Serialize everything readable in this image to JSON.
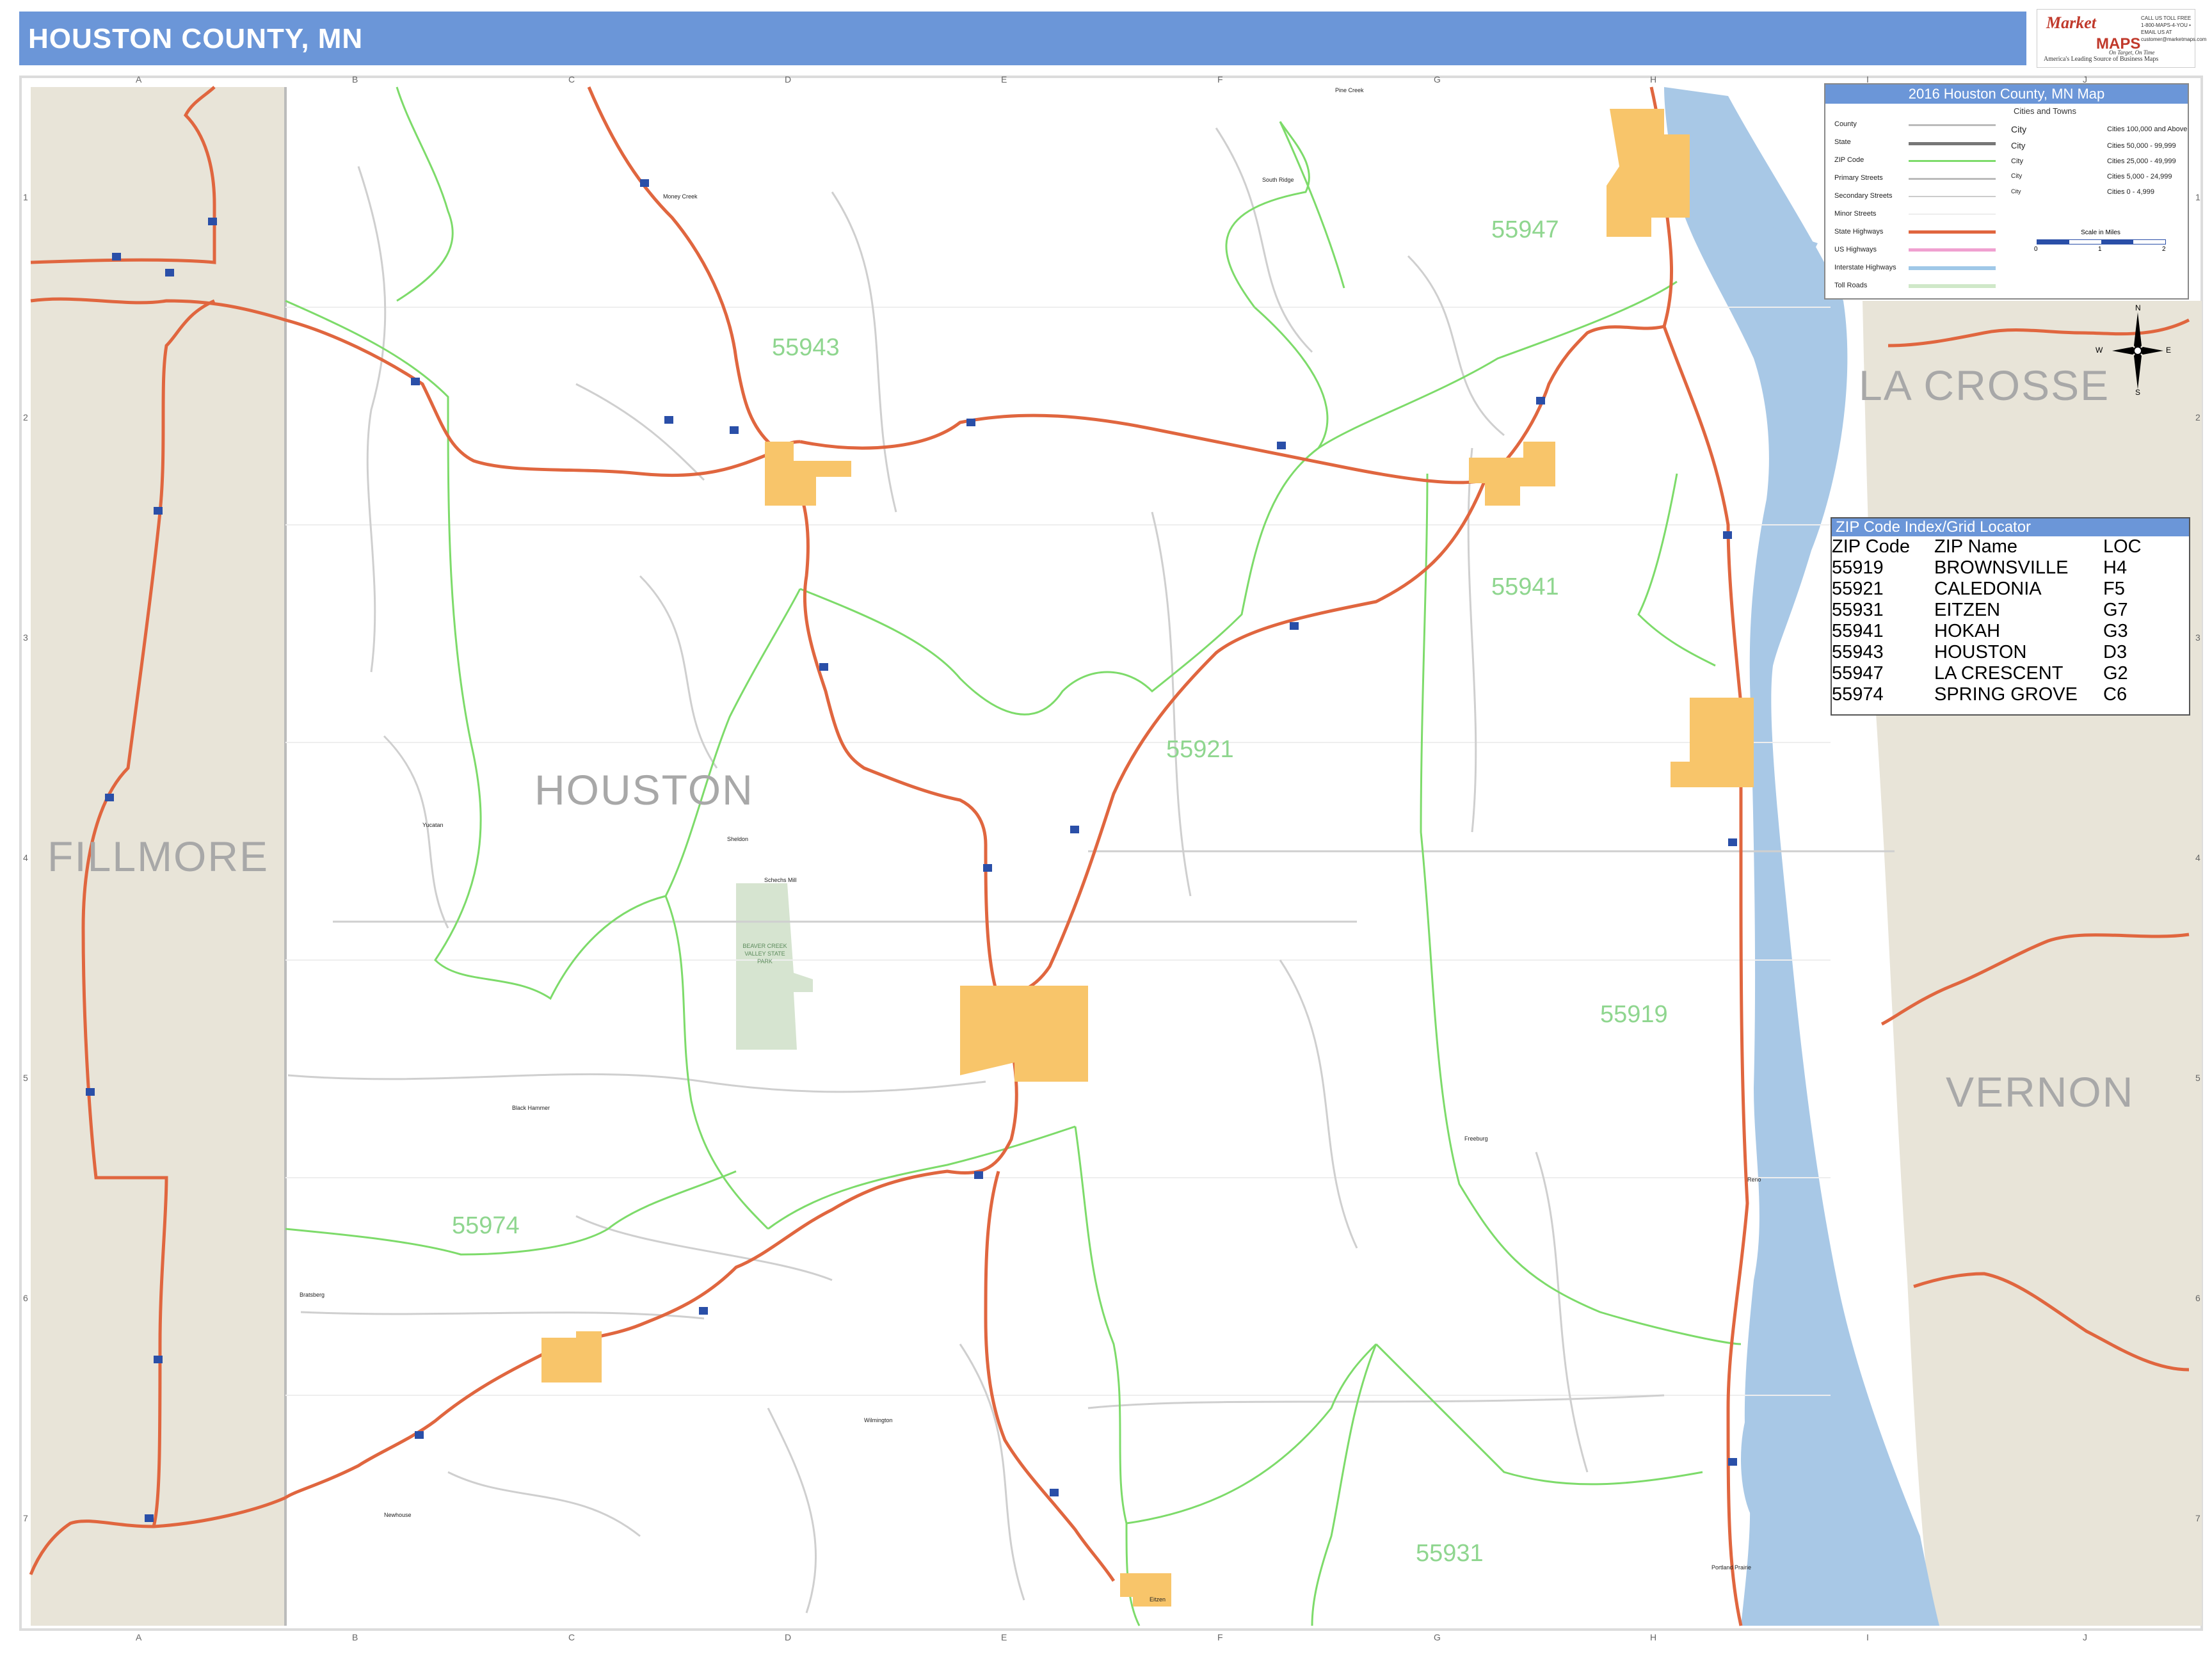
{
  "header": {
    "title": "HOUSTON COUNTY, MN"
  },
  "logo": {
    "brand_top": "Market",
    "brand_bottom": "MAPS",
    "tagline": "On Target, On Time",
    "subtitle": "America's Leading Source of Business Maps",
    "contact": "CALL US TOLL FREE 1-800-MAPS-4-YOU • EMAIL US AT customer@marketmaps.com"
  },
  "colors": {
    "header_blue": "#6b96d8",
    "water": "#a8c8e6",
    "adjacent_county": "#e8e4d8",
    "city_fill": "#f8c56a",
    "state_highway": "#e0663f",
    "zip_boundary": "#7ddb6a",
    "park": "#d6e4d0",
    "grid_line": "#dcdcdc"
  },
  "legend": {
    "title": "2016 Houston County, MN Map",
    "cities_header": "Cities and Towns",
    "rows": [
      {
        "label": "County",
        "icon": "county-line"
      },
      {
        "label": "State",
        "icon": "state-line"
      },
      {
        "label": "ZIP Code",
        "icon": "zip-line"
      },
      {
        "label": "Primary Streets",
        "icon": "primary-street-line"
      },
      {
        "label": "Secondary Streets",
        "icon": "secondary-street-line"
      },
      {
        "label": "Minor Streets",
        "icon": "minor-street-line"
      },
      {
        "label": "State Highways",
        "icon": "state-highway-line"
      },
      {
        "label": "US Highways",
        "icon": "us-highway-line"
      },
      {
        "label": "Interstate Highways",
        "icon": "interstate-line"
      },
      {
        "label": "Toll Roads",
        "icon": "toll-road-line"
      }
    ],
    "city_sizes": [
      {
        "name": "City",
        "population": "Cities 100,000 and Above"
      },
      {
        "name": "City",
        "population": "Cities 50,000 - 99,999"
      },
      {
        "name": "City",
        "population": "Cities 25,000 - 49,999"
      },
      {
        "name": "City",
        "population": "Cities 5,000 - 24,999"
      },
      {
        "name": "City",
        "population": "Cities 0 - 4,999"
      }
    ],
    "scale_title": "Scale in Miles",
    "scale_ticks": [
      "0",
      "1",
      "2"
    ]
  },
  "zip_index": {
    "title": "ZIP Code Index/Grid Locator",
    "columns": [
      "ZIP Code",
      "ZIP Name",
      "LOC"
    ],
    "rows": [
      [
        "55919",
        "BROWNSVILLE",
        "H4"
      ],
      [
        "55921",
        "CALEDONIA",
        "F5"
      ],
      [
        "55931",
        "EITZEN",
        "G7"
      ],
      [
        "55941",
        "HOKAH",
        "G3"
      ],
      [
        "55943",
        "HOUSTON",
        "D3"
      ],
      [
        "55947",
        "LA CRESCENT",
        "G2"
      ],
      [
        "55974",
        "SPRING GROVE",
        "C6"
      ]
    ]
  },
  "counties": {
    "houston": "HOUSTON",
    "fillmore": "FILLMORE",
    "la_crosse": "LA CROSSE",
    "vernon": "VERNON"
  },
  "zip_labels": {
    "z55943": "55943",
    "z55947": "55947",
    "z55941": "55941",
    "z55921": "55921",
    "z55919": "55919",
    "z55974": "55974",
    "z55931": "55931"
  },
  "grid": {
    "columns": [
      "A",
      "B",
      "C",
      "D",
      "E",
      "F",
      "G",
      "H",
      "I",
      "J"
    ],
    "rows": [
      "1",
      "2",
      "3",
      "4",
      "5",
      "6",
      "7"
    ]
  },
  "compass": {
    "n": "N",
    "e": "E",
    "s": "S",
    "w": "W"
  },
  "towns": {
    "money_creek": "Money Creek",
    "pine_creek": "Pine Creek",
    "south_ridge": "South Ridge",
    "sheldon": "Sheldon",
    "schechs_mill": "Schechs Mill",
    "yucatan": "Yucatan",
    "black_hammer": "Black Hammer",
    "bratsberg": "Bratsberg",
    "wilmington": "Wilmington",
    "freeburg": "Freeburg",
    "reno": "Reno",
    "newhouse": "Newhouse",
    "eitzen": "Eitzen",
    "portland_prairie": "Portland Prairie",
    "park_name": "BEAVER CREEK VALLEY STATE PARK"
  }
}
